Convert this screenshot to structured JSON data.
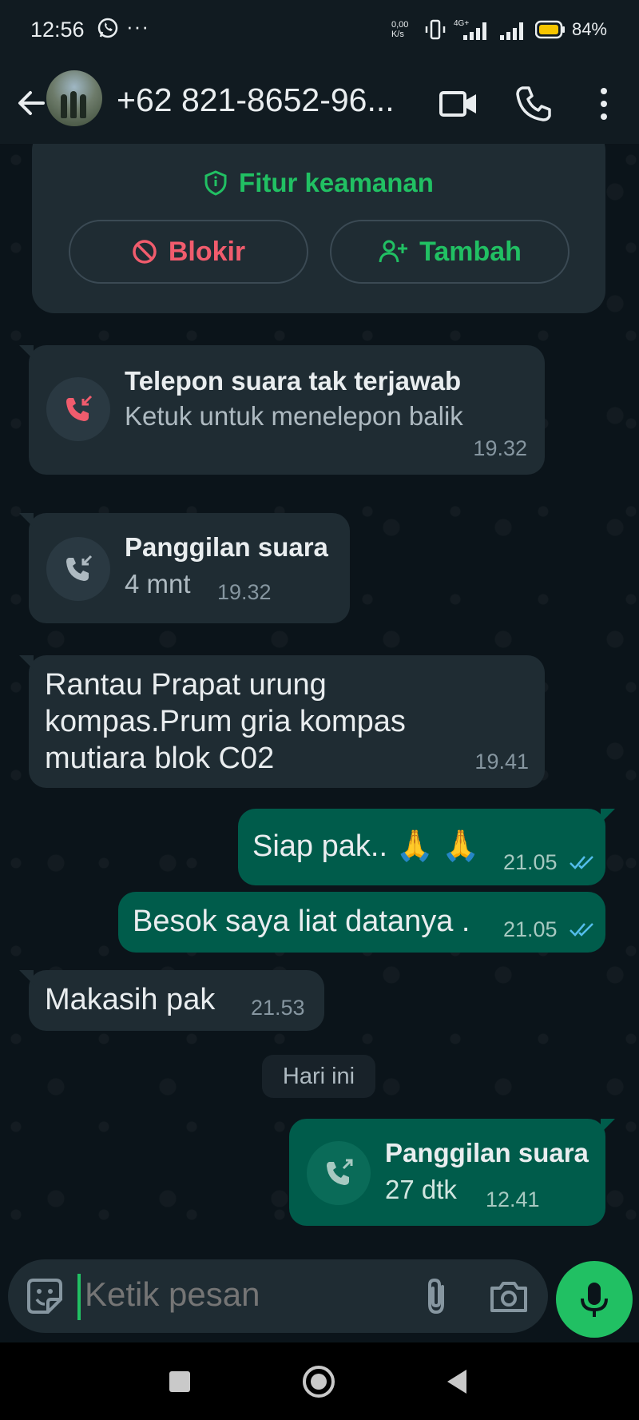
{
  "status_bar": {
    "time": "12:56",
    "dots": "···",
    "net_speed_value": "0,00",
    "net_speed_unit": "K/s",
    "network": "4G+",
    "battery": "84%"
  },
  "header": {
    "contact_name": "+62 821-8652-96...",
    "icons": [
      "back-arrow-icon",
      "video-call-icon",
      "voice-call-icon",
      "more-vert-icon"
    ]
  },
  "security_card": {
    "title": "Fitur keamanan",
    "block_label": "Blokir",
    "add_label": "Tambah"
  },
  "messages": [
    {
      "kind": "missed-call",
      "title": "Telepon suara tak terjawab",
      "subtitle": "Ketuk untuk menelepon balik",
      "time": "19.32",
      "direction": "in"
    },
    {
      "kind": "voice-call",
      "title": "Panggilan suara",
      "subtitle": "4 mnt",
      "time": "19.32",
      "direction": "in"
    },
    {
      "kind": "text",
      "lines": [
        "Rantau Prapat urung",
        "kompas.Prum gria kompas",
        "mutiara blok C02"
      ],
      "time": "19.41",
      "direction": "in"
    },
    {
      "kind": "text",
      "text": "Siap pak.. 🙏 🙏",
      "time": "21.05",
      "direction": "out",
      "status": "read"
    },
    {
      "kind": "text",
      "text": "Besok saya liat datanya .",
      "time": "21.05",
      "direction": "out",
      "status": "read"
    },
    {
      "kind": "text",
      "text": "Makasih pak",
      "time": "21.53",
      "direction": "in"
    },
    {
      "kind": "voice-call",
      "title": "Panggilan suara",
      "subtitle": "27 dtk",
      "time": "12.41",
      "direction": "out"
    }
  ],
  "date_chip": "Hari ini",
  "input": {
    "placeholder": "Ketik pesan"
  },
  "colors": {
    "background": "#0b141a",
    "bar": "#111b21",
    "incoming_bubble": "#1f2c33",
    "outgoing_bubble": "#005c4b",
    "accent_green": "#21c063",
    "danger_red": "#f15c6d",
    "read_tick_blue": "#53bdeb"
  }
}
